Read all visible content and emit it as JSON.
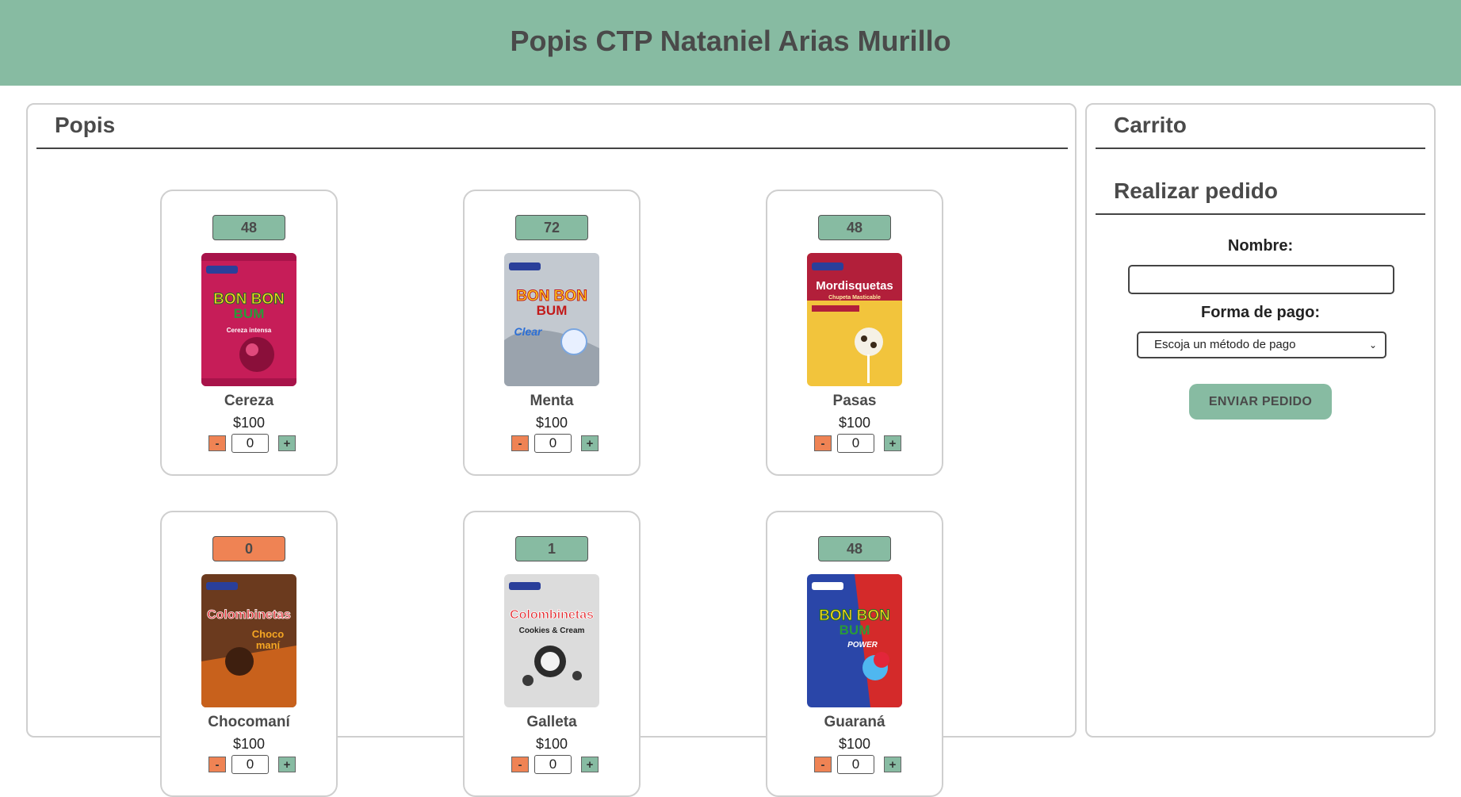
{
  "header": {
    "title": "Popis CTP Nataniel Arias Murillo"
  },
  "products_panel": {
    "title": "Popis"
  },
  "products": [
    {
      "stock": "48",
      "name": "Cereza",
      "price": "$100",
      "qty": "0",
      "stock_status": "available",
      "image": "bonbonbum-cereza",
      "bag_color": "#c61d58",
      "brand": "BON BON BUM",
      "flavor_text": "Cereza intensa"
    },
    {
      "stock": "72",
      "name": "Menta",
      "price": "$100",
      "qty": "0",
      "stock_status": "available",
      "image": "bonbonbum-clear-menta",
      "bag_color": "#bfc5cc",
      "brand": "BON BON BUM",
      "flavor_text": "Clear"
    },
    {
      "stock": "48",
      "name": "Pasas",
      "price": "$100",
      "qty": "0",
      "stock_status": "available",
      "image": "mordisquetas-pasas",
      "bag_color": "#f2c43c",
      "brand": "Mordisquetas",
      "flavor_text": "Chupeta Masticable"
    },
    {
      "stock": "0",
      "name": "Chocomaní",
      "price": "$100",
      "qty": "0",
      "stock_status": "out",
      "image": "colombinetas-chocomani",
      "bag_color": "#6b3a1e",
      "brand": "Colombinetas",
      "flavor_text": "Choco maní"
    },
    {
      "stock": "1",
      "name": "Galleta",
      "price": "$100",
      "qty": "0",
      "stock_status": "available",
      "image": "colombinetas-cookies-cream",
      "bag_color": "#d9d9d9",
      "brand": "Colombinetas",
      "flavor_text": "Cookies & Cream"
    },
    {
      "stock": "48",
      "name": "Guaraná",
      "price": "$100",
      "qty": "0",
      "stock_status": "available",
      "image": "bonbonbum-power-guarana",
      "bag_color": "#2a46a8",
      "brand": "BON BON BUM",
      "flavor_text": "POWER"
    }
  ],
  "cart_panel": {
    "title": "Carrito",
    "order_title": "Realizar pedido",
    "name_label": "Nombre:",
    "name_value": "",
    "payment_label": "Forma de pago:",
    "payment_selected": "Escoja un método de pago",
    "submit_label": "ENVIAR PEDIDO"
  },
  "colors": {
    "header_bg": "#87bba2",
    "accent_green": "#87bba2",
    "accent_orange": "#ef8354",
    "text_dark": "#4a4a4a"
  },
  "icons": {
    "decrement": "-",
    "increment": "+",
    "select_arrow": "⌄"
  }
}
